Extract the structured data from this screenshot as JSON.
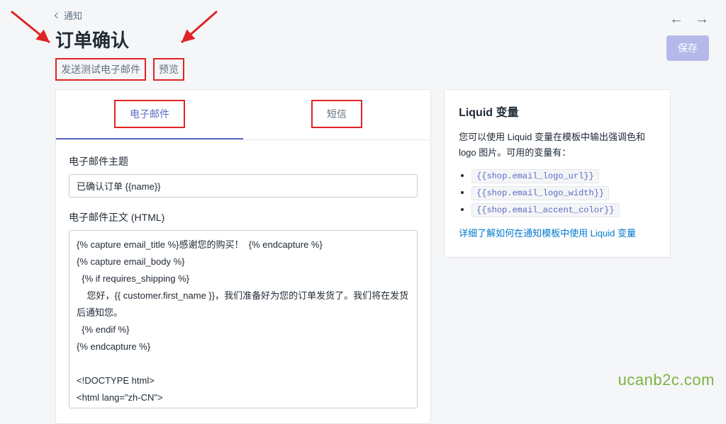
{
  "breadcrumb": {
    "label": "通知"
  },
  "page": {
    "title": "订单确认"
  },
  "actions": {
    "send_test_email": "发送测试电子邮件",
    "preview": "预览",
    "save": "保存"
  },
  "tabs": {
    "email": "电子邮件",
    "sms": "短信"
  },
  "fields": {
    "subject_label": "电子邮件主题",
    "subject_value": "已确认订单 {{name}}",
    "body_label": "电子邮件正文 (HTML)",
    "body_value": "{% capture email_title %}感谢您的购买！  {% endcapture %}\n{% capture email_body %}\n  {% if requires_shipping %}\n    您好，{{ customer.first_name }}，我们准备好为您的订单发货了。我们将在发货后通知您。\n  {% endif %}\n{% endcapture %}\n\n<!DOCTYPE html>\n<html lang=\"zh-CN\">\n  <head>\n  <title>{{ email_title }}</title>"
  },
  "sidebar": {
    "title": "Liquid 变量",
    "desc": "您可以使用 Liquid 变量在模板中输出强调色和 logo 图片。可用的变量有：",
    "vars": [
      "{{shop.email_logo_url}}",
      "{{shop.email_logo_width}}",
      "{{shop.email_accent_color}}"
    ],
    "link": "详细了解如何在通知模板中使用 Liquid 变量"
  },
  "watermark": "ucanb2c.com",
  "colors": {
    "highlight_box": "#e02424",
    "accent": "#5c6ac4"
  }
}
